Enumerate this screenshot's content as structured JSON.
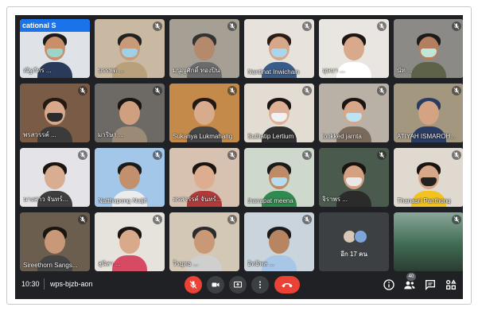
{
  "meeting": {
    "time": "10:30",
    "code": "wps-bjzb-aon",
    "participant_count": "40"
  },
  "banner_text": "cational S",
  "tiles": [
    {
      "name": "ณัฐภัทร ...",
      "bg": "#dfe3e8",
      "skin": "#c98f6b",
      "hair": "#1b1b1b",
      "shirt": "#2a3a5a",
      "mask": "#9bd4c9",
      "banner": true
    },
    {
      "name": "บรรพต ...",
      "bg": "#c9b8a2",
      "skin": "#c99a78",
      "hair": "#222",
      "shirt": "#b8a07a",
      "mask": "#9fd0ea"
    },
    {
      "name": "มนูญศักดิ์ ทองปิน",
      "bg": "#a59f94",
      "skin": "#b58a6c",
      "hair": "#333",
      "shirt": "#6b6b6b",
      "mask": ""
    },
    {
      "name": "Nantinat Inwichain",
      "bg": "#e7e2db",
      "skin": "#d6a88a",
      "hair": "#2b1d16",
      "shirt": "#3a5c8a",
      "mask": "#a9d6ef"
    },
    {
      "name": "บุษบา ...",
      "bg": "#e9e6e1",
      "skin": "#d9a98b",
      "hair": "#1e1612",
      "shirt": "#ffffff",
      "mask": ""
    },
    {
      "name": "นัท ...",
      "bg": "#8c8a86",
      "skin": "#b47f60",
      "hair": "#1b1b1b",
      "shirt": "#5e6248",
      "mask": "#bfe6d8"
    },
    {
      "name": "พรสวรรค์ ...",
      "bg": "#7a5c46",
      "skin": "#d7a889",
      "hair": "#241811",
      "shirt": "#3b3b3b",
      "mask": "#2b2b2b"
    },
    {
      "name": "มาริษา ...",
      "bg": "#6d6a66",
      "skin": "#cfa080",
      "hair": "#1b1512",
      "shirt": "#9b8a76",
      "mask": ""
    },
    {
      "name": "Sukanya Lukmahang",
      "bg": "#c38a4a",
      "skin": "#d8ab8c",
      "hair": "#221812",
      "shirt": "#444",
      "mask": ""
    },
    {
      "name": "Suthatip Lertium",
      "bg": "#e3dcd2",
      "skin": "#deb095",
      "hair": "#1d1511",
      "shirt": "#2f2f2f",
      "mask": "#f1f1f1"
    },
    {
      "name": "lookked jarnta",
      "bg": "#b9b1a6",
      "skin": "#d8a78a",
      "hair": "#1b1511",
      "shirt": "#7a6a5c",
      "mask": "#bde3f3"
    },
    {
      "name": "ATIYAH ISMAROH...",
      "bg": "#a3977f",
      "skin": "#d3a383",
      "hair": "#2a3c63",
      "shirt": "#2a3c63",
      "mask": ""
    },
    {
      "name": "นางสาว จันทร์...",
      "bg": "#e4e3e7",
      "skin": "#d8ad92",
      "hair": "#1b1512",
      "shirt": "#3e3e3e",
      "mask": ""
    },
    {
      "name": "Natthapong Naijit",
      "bg": "#a3c7e8",
      "skin": "#c3906e",
      "hair": "#1b1b1b",
      "shirt": "#ececec",
      "mask": ""
    },
    {
      "name": "พรสวรรค์ จันทร์...",
      "bg": "#d7c2b1",
      "skin": "#dcad8f",
      "hair": "#1c1410",
      "shirt": "#b03a3a",
      "mask": ""
    },
    {
      "name": "thanapat meena",
      "bg": "#cfd8cc",
      "skin": "#bd8b68",
      "hair": "#1b1b1b",
      "shirt": "#2e8a4e",
      "mask": "#b5dcef"
    },
    {
      "name": "จิราพร ...",
      "bg": "#4a5a4c",
      "skin": "#d3a181",
      "hair": "#1a1410",
      "shirt": "#2b2b2b",
      "mask": "#e8e8e8"
    },
    {
      "name": "Thanasri Panthong",
      "bg": "#dfd9cf",
      "skin": "#d6a789",
      "hair": "#1b1511",
      "shirt": "#f2c21f",
      "mask": "#222"
    },
    {
      "name": "Sireethorn Sangs...",
      "bg": "#6c5e4f",
      "skin": "#c99878",
      "hair": "#1b1511",
      "shirt": "#444",
      "mask": ""
    },
    {
      "name": "สุนิสา ...",
      "bg": "#e6e2dc",
      "skin": "#d8a98b",
      "hair": "#1b1511",
      "shirt": "#d74a63",
      "mask": ""
    },
    {
      "name": "วีรยุทธ ...",
      "bg": "#d3c7b5",
      "skin": "#c99876",
      "hair": "#2b2b2b",
      "shirt": "#cfcfcf",
      "mask": ""
    },
    {
      "name": "อิทธิพล ...",
      "bg": "#c9d4dc",
      "skin": "#b88563",
      "hair": "#1b1b1b",
      "shirt": "#a8c7e6",
      "mask": ""
    }
  ],
  "others": {
    "label": "อีก 17 คน",
    "avatar_colors": [
      "#d9c7b6",
      "#7fa6d9"
    ]
  },
  "last_tile": {
    "bg": "#3f6b52",
    "name": ""
  },
  "controls": {
    "mic": "mic-off-icon",
    "camera": "camera-icon",
    "present": "present-icon",
    "more": "more-vert-icon",
    "hangup": "hangup-icon"
  },
  "right_controls": [
    "info-icon",
    "people-icon",
    "chat-icon",
    "activities-icon"
  ],
  "colors": {
    "background": "#202124",
    "tile": "#3c4043",
    "hangup": "#ea4335",
    "white": "#ffffff"
  }
}
